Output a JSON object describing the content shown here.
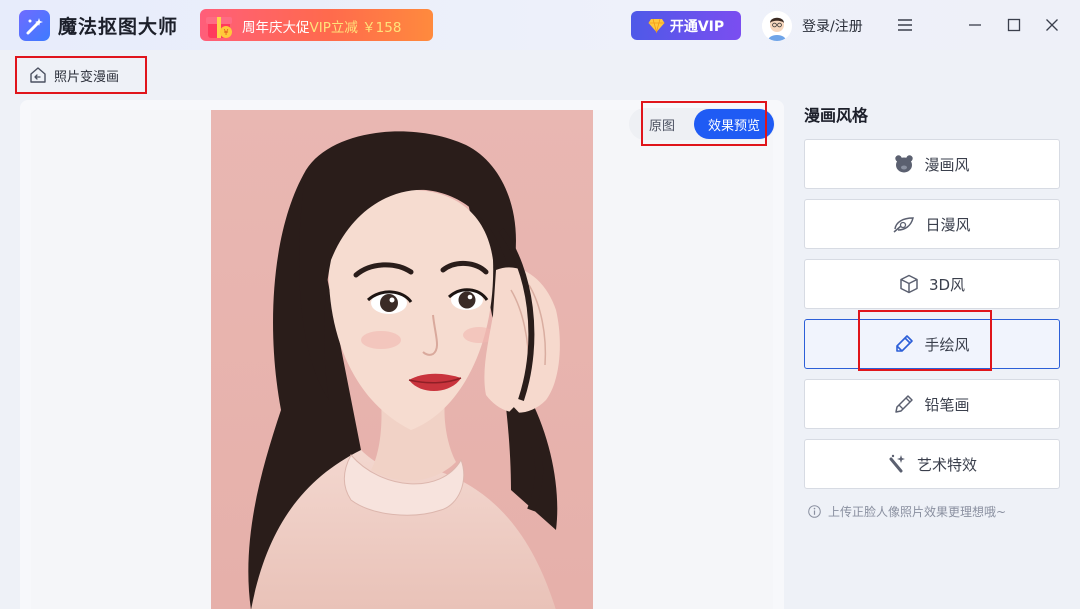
{
  "app": {
    "name": "魔法抠图大师"
  },
  "promo": {
    "text_prefix": "周年庆大促",
    "text_highlight": "VIP立减 ￥158"
  },
  "header": {
    "vip_label": "开通VIP",
    "login_label": "登录/注册"
  },
  "breadcrumb": {
    "label": "照片变漫画"
  },
  "preview": {
    "toggle_original": "原图",
    "toggle_effect": "效果预览"
  },
  "styles": {
    "heading": "漫画风格",
    "items": [
      {
        "label": "漫画风",
        "icon": "bear-icon"
      },
      {
        "label": "日漫风",
        "icon": "leaf-icon"
      },
      {
        "label": "3D风",
        "icon": "cube-icon"
      },
      {
        "label": "手绘风",
        "icon": "brush-icon",
        "selected": true
      },
      {
        "label": "铅笔画",
        "icon": "pencil-icon"
      },
      {
        "label": "艺术特效",
        "icon": "magic-wand-icon"
      }
    ],
    "hint": "上传正脸人像照片效果更理想哦~"
  },
  "colors": {
    "accent": "#1f5bf4",
    "highlight_box": "#e0151b",
    "promo_gradient_start": "#ff5e7a",
    "vip_gradient_start": "#4e59e8"
  }
}
